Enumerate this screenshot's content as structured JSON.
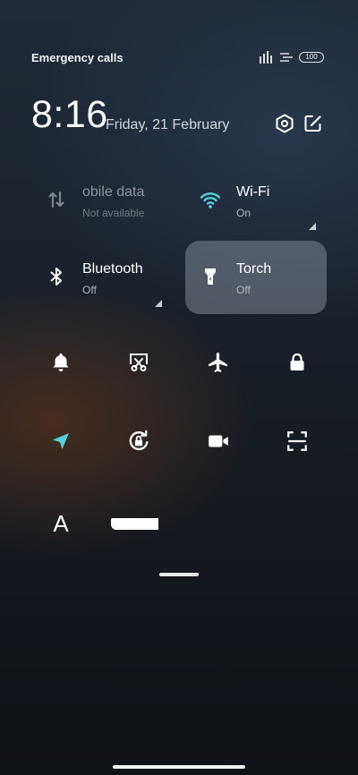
{
  "status_bar": {
    "carrier_text": "Emergency calls o",
    "battery_level": "100"
  },
  "header": {
    "time": "8:16",
    "date": "Friday, 21 February"
  },
  "tiles": [
    {
      "label": "obile data",
      "sub": "Not available",
      "icon": "mobile-data-icon",
      "state": "disabled"
    },
    {
      "label": "Wi-Fi",
      "sub": "On",
      "icon": "wifi-icon",
      "state": "on"
    },
    {
      "label": "Bluetooth",
      "sub": "Off",
      "icon": "bluetooth-icon",
      "state": "off"
    },
    {
      "label": "Torch",
      "sub": "Off",
      "icon": "torch-icon",
      "state": "active"
    }
  ],
  "toggles_row1": [
    "bell-icon",
    "screenshot-icon",
    "airplane-icon",
    "lock-icon"
  ],
  "toggles_row2": [
    "location-icon",
    "rotation-lock-icon",
    "video-camera-icon",
    "scanner-icon"
  ],
  "toggles_row3": {
    "font_glyph": "A"
  },
  "colors": {
    "accent": "#4fd1d9",
    "tile_active": "#8f98a3"
  }
}
